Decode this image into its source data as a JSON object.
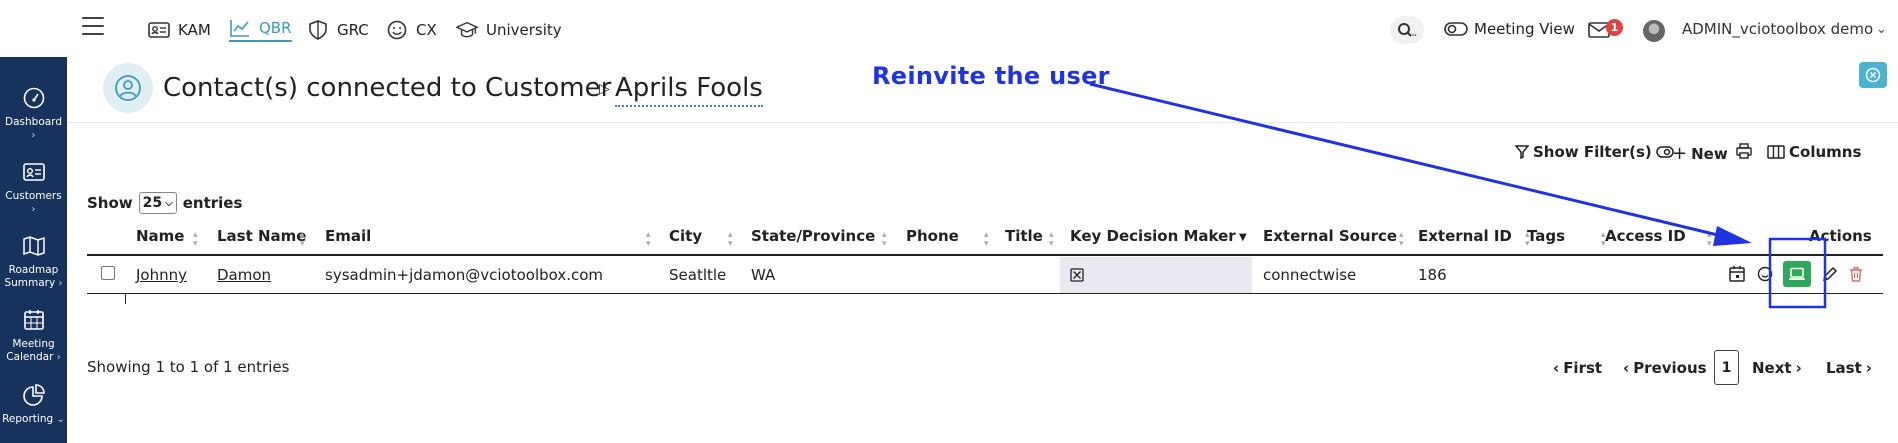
{
  "topnav": {
    "items": [
      {
        "label": "KAM",
        "icon": "id-card-icon"
      },
      {
        "label": "QBR",
        "icon": "chart-line-icon",
        "active": true
      },
      {
        "label": "GRC",
        "icon": "shield-icon"
      },
      {
        "label": "CX",
        "icon": "smile-icon"
      },
      {
        "label": "University",
        "icon": "graduation-cap-icon"
      }
    ],
    "meeting_view": "Meeting View",
    "mail_count": "1",
    "user": "ADMIN_vciotoolbox demo"
  },
  "sidebar": {
    "items": [
      {
        "label": "Dashboard",
        "icon": "gauge-icon"
      },
      {
        "label": "Customers",
        "icon": "address-card-icon"
      },
      {
        "label": "Roadmap Summary",
        "icon": "map-icon"
      },
      {
        "label": "Meeting Calendar",
        "icon": "calendar-icon"
      },
      {
        "label": "Reporting",
        "icon": "pie-chart-icon"
      }
    ]
  },
  "page": {
    "title": "Contact(s) connected to Customer",
    "customer": "Aprils Fools"
  },
  "annotation": {
    "text": "Reinvite the user",
    "color": "#1f34e0"
  },
  "toolbar": {
    "show_filters": "Show Filter(s)",
    "new": "New",
    "columns": "Columns"
  },
  "entries": {
    "show": "Show",
    "value": "25",
    "suffix": "entries"
  },
  "table": {
    "columns": [
      "Name",
      "Last Name",
      "Email",
      "City",
      "State/Province",
      "Phone",
      "Title",
      "Key Decision Maker",
      "External Source",
      "External ID",
      "Tags",
      "Access ID",
      "Actions"
    ],
    "rows": [
      {
        "name": "Johnny",
        "last_name": "Damon",
        "email": "sysadmin+jdamon@vciotoolbox.com",
        "city": "Seatltle",
        "state": "WA",
        "phone": "",
        "title": "",
        "external_source": "connectwise",
        "external_id": "186",
        "tags": "",
        "access_id": ""
      }
    ]
  },
  "footer": {
    "info": "Showing 1 to 1 of 1 entries",
    "first": "First",
    "previous": "Previous",
    "page": "1",
    "next": "Next",
    "last": "Last"
  },
  "colors": {
    "sidebar": "#17325c",
    "accent": "#3b9ac4",
    "reinvite_button": "#2ea85a",
    "badge": "#e14343"
  }
}
